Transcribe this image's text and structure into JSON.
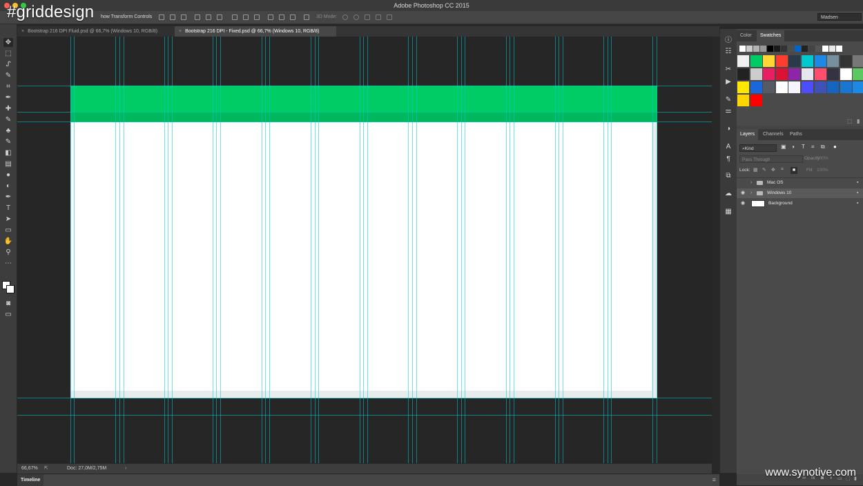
{
  "app": {
    "title": "Adobe Photoshop CC 2015",
    "traffic_lights": [
      "#fc5f57",
      "#fdbc2e",
      "#34c84a"
    ]
  },
  "watermarks": {
    "tag": "#griddesign",
    "site": "www.synotive.com"
  },
  "options_bar": {
    "show_transform_label": "how Transform Controls",
    "mode_3d_label": "3D Mode:",
    "workspace": "Madsen"
  },
  "tools": [
    "move-tool",
    "marquee-tool",
    "lasso-tool",
    "quick-select-tool",
    "crop-tool",
    "eyedropper-tool",
    "healing-brush-tool",
    "brush-tool",
    "clone-stamp-tool",
    "history-brush-tool",
    "eraser-tool",
    "gradient-tool",
    "blur-tool",
    "dodge-tool",
    "pen-tool",
    "type-tool",
    "path-select-tool",
    "rectangle-tool",
    "hand-tool",
    "zoom-tool",
    "more-tools"
  ],
  "tool_glyphs": [
    "✥",
    "⬚",
    "ᔑ",
    "✎",
    "⌗",
    "✒",
    "✚",
    "✎",
    "♣",
    "✎",
    "◧",
    "▤",
    "●",
    "◐",
    "✒",
    "T",
    "➤",
    "▭",
    "✋",
    "⚲",
    "⋯"
  ],
  "tabs": [
    {
      "label": "Bootstrap 216 DPI Fluid.psd @ 66,7% (Windows 10, RGB/8)",
      "active": false
    },
    {
      "label": "Bootstrap 216 DPI - Fixed.psd @ 66,7% (Windows 10, RGB/8)",
      "active": true
    }
  ],
  "canvas": {
    "header_color": "#00cc66",
    "body_color": "#ffffff",
    "guide_color": "#00cbd6"
  },
  "status": {
    "zoom": "66,67%",
    "doc": "Doc: 27,0M/2,75M"
  },
  "timeline": {
    "label": "Timeline"
  },
  "dock_icons": [
    "info-icon",
    "adjustments-icon",
    "actions-icon",
    "play-icon",
    "brush-preset-icon",
    "properties-icon",
    "styles-icon",
    "character-icon",
    "paragraph-icon",
    "clone-source-icon",
    "libraries-icon",
    "navigator-icon"
  ],
  "dock_glyphs": [
    "ⓘ",
    "☷",
    "✂",
    "▶",
    "✎",
    "⚌",
    "◑",
    "A",
    "¶",
    "⧉",
    "☁",
    "▦"
  ],
  "color_panel": {
    "tabs": [
      {
        "label": "Color",
        "active": false
      },
      {
        "label": "Swatches",
        "active": true
      }
    ],
    "top_row": [
      "#ffffff",
      "#cccccc",
      "#b2b2b2",
      "#999999",
      "#000000",
      "#1a1a1a",
      "#333333",
      "#4d4d4d",
      "#0066cc",
      "#222222",
      "#444444",
      "#555555",
      "#ffffff",
      "#e8e8e8",
      "#ffffff"
    ],
    "big_swatches": [
      "#f0f0f0",
      "#00cc66",
      "#ffd633",
      "#ff3d2e",
      "#2a3a4a",
      "#00c8d0",
      "#1e88e5",
      "#78909c",
      "#333333",
      "#777777",
      "#222222",
      "#cccccc",
      "#e91e63",
      "#dd1133",
      "#8e24aa",
      "#e6e6f0",
      "#ff4d6d",
      "#333344",
      "#ffffff",
      "#5cc860",
      "#ffe600",
      "#1a66dd",
      "#555b66",
      "#ffffff",
      "#f5f5ff",
      "#4d4dff",
      "#3f51b5",
      "#1565c0",
      "#1976d2",
      "#1e88e5",
      "#ffd500",
      "#ff0000"
    ]
  },
  "layers_panel": {
    "tabs": [
      {
        "label": "Layers",
        "active": true
      },
      {
        "label": "Channels",
        "active": false
      },
      {
        "label": "Paths",
        "active": false
      }
    ],
    "filter_kind": "Kind",
    "blend_mode": "Pass Through",
    "opacity_label": "Opacity:",
    "opacity_value": "100%",
    "lock_label": "Lock:",
    "fill_label": "Fill:",
    "fill_value": "100%",
    "layers": [
      {
        "name": "Mac OS",
        "type": "group",
        "visible": false,
        "selected": false,
        "locked": true
      },
      {
        "name": "Windows 10",
        "type": "group",
        "visible": true,
        "selected": true,
        "locked": true
      },
      {
        "name": "Background",
        "type": "pixel",
        "visible": true,
        "selected": false,
        "locked": true
      }
    ]
  }
}
